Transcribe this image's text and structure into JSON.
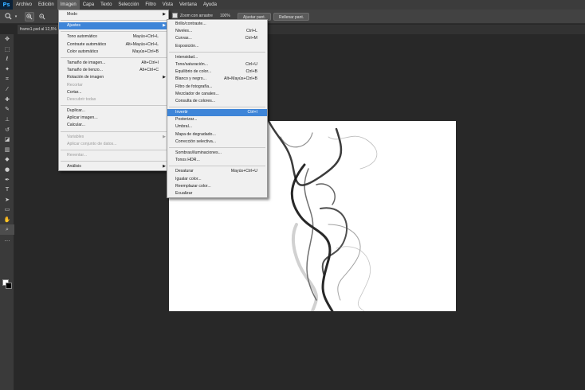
{
  "app": {
    "logo": "Ps"
  },
  "menubar": {
    "items": [
      "Archivo",
      "Edición",
      "Imagen",
      "Capa",
      "Texto",
      "Selección",
      "Filtro",
      "Vista",
      "Ventana",
      "Ayuda"
    ],
    "active": "Imagen"
  },
  "options": {
    "zoom_drag_label": "Zoom con arrastre",
    "zoom_value": "100%",
    "fit_screen_label": "Ajustar pant.",
    "fill_screen_label": "Rellenar pant."
  },
  "document": {
    "tab_title": "framo1.psd al 12,5%"
  },
  "image_menu": {
    "items": [
      {
        "label": "Modo",
        "shortcut": "",
        "submenu": true,
        "disabled": false
      },
      {
        "sep": true
      },
      {
        "label": "Ajustes",
        "shortcut": "",
        "submenu": true,
        "disabled": false,
        "open": true
      },
      {
        "sep": true
      },
      {
        "label": "Tono automático",
        "shortcut": "Mayús+Ctrl+L",
        "submenu": false,
        "disabled": false
      },
      {
        "label": "Contraste automático",
        "shortcut": "Alt+Mayús+Ctrl+L",
        "submenu": false,
        "disabled": false
      },
      {
        "label": "Color automático",
        "shortcut": "Mayús+Ctrl+B",
        "submenu": false,
        "disabled": false
      },
      {
        "sep": true
      },
      {
        "label": "Tamaño de imagen...",
        "shortcut": "Alt+Ctrl+I",
        "submenu": false,
        "disabled": false
      },
      {
        "label": "Tamaño de lienzo...",
        "shortcut": "Alt+Ctrl+C",
        "submenu": false,
        "disabled": false
      },
      {
        "label": "Rotación de imagen",
        "shortcut": "",
        "submenu": true,
        "disabled": false
      },
      {
        "label": "Recortar",
        "shortcut": "",
        "submenu": false,
        "disabled": true
      },
      {
        "label": "Cortar...",
        "shortcut": "",
        "submenu": false,
        "disabled": false
      },
      {
        "label": "Descubrir todas",
        "shortcut": "",
        "submenu": false,
        "disabled": true
      },
      {
        "sep": true
      },
      {
        "label": "Duplicar...",
        "shortcut": "",
        "submenu": false,
        "disabled": false
      },
      {
        "label": "Aplicar imagen...",
        "shortcut": "",
        "submenu": false,
        "disabled": false
      },
      {
        "label": "Calcular...",
        "shortcut": "",
        "submenu": false,
        "disabled": false
      },
      {
        "sep": true
      },
      {
        "label": "Variables",
        "shortcut": "",
        "submenu": true,
        "disabled": true
      },
      {
        "label": "Aplicar conjunto de datos...",
        "shortcut": "",
        "submenu": false,
        "disabled": true
      },
      {
        "sep": true
      },
      {
        "label": "Reventar...",
        "shortcut": "",
        "submenu": false,
        "disabled": true
      },
      {
        "sep": true
      },
      {
        "label": "Análisis",
        "shortcut": "",
        "submenu": true,
        "disabled": false
      }
    ]
  },
  "adjust_menu": {
    "items": [
      {
        "label": "Brillo/contraste...",
        "shortcut": ""
      },
      {
        "label": "Niveles...",
        "shortcut": "Ctrl+L"
      },
      {
        "label": "Curvas...",
        "shortcut": "Ctrl+M"
      },
      {
        "label": "Exposición...",
        "shortcut": ""
      },
      {
        "sep": true
      },
      {
        "label": "Intensidad...",
        "shortcut": ""
      },
      {
        "label": "Tono/saturación...",
        "shortcut": "Ctrl+U"
      },
      {
        "label": "Equilibrio de color...",
        "shortcut": "Ctrl+B"
      },
      {
        "label": "Blanco y negro...",
        "shortcut": "Alt+Mayús+Ctrl+B"
      },
      {
        "label": "Filtro de fotografía...",
        "shortcut": ""
      },
      {
        "label": "Mezclador de canales...",
        "shortcut": ""
      },
      {
        "label": "Consulta de colores...",
        "shortcut": ""
      },
      {
        "sep": true
      },
      {
        "label": "Invertir",
        "shortcut": "Ctrl+I",
        "highlight": true
      },
      {
        "label": "Posterizar...",
        "shortcut": ""
      },
      {
        "label": "Umbral...",
        "shortcut": ""
      },
      {
        "label": "Mapa de degradado...",
        "shortcut": ""
      },
      {
        "label": "Corrección selectiva...",
        "shortcut": ""
      },
      {
        "sep": true
      },
      {
        "label": "Sombras/iluminaciones...",
        "shortcut": ""
      },
      {
        "label": "Tonos HDR...",
        "shortcut": ""
      },
      {
        "sep": true
      },
      {
        "label": "Desaturar",
        "shortcut": "Mayús+Ctrl+U"
      },
      {
        "label": "Igualar color...",
        "shortcut": ""
      },
      {
        "label": "Reemplazar color...",
        "shortcut": ""
      },
      {
        "label": "Ecualizar",
        "shortcut": ""
      }
    ]
  },
  "tools": [
    "move-tool",
    "marquee-tool",
    "lasso-tool",
    "magic-wand-tool",
    "crop-tool",
    "eyedropper-tool",
    "spot-healing-tool",
    "brush-tool",
    "clone-stamp-tool",
    "history-brush-tool",
    "eraser-tool",
    "gradient-tool",
    "blur-tool",
    "dodge-tool",
    "pen-tool",
    "type-tool",
    "path-selection-tool",
    "rectangle-tool",
    "hand-tool",
    "zoom-tool",
    "more-tools"
  ],
  "colors": {
    "highlight": "#3e85d8",
    "workspace": "#282828",
    "foreground": "#ffffff",
    "background": "#000000"
  }
}
